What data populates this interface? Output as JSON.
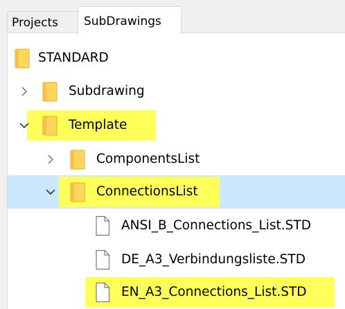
{
  "tabs": [
    {
      "label": "Projects",
      "active": false
    },
    {
      "label": "SubDrawings",
      "active": true
    }
  ],
  "tree": [
    {
      "label": "STANDARD",
      "type": "folder",
      "depth": 0,
      "state": "none",
      "selected": false,
      "highlighted": false
    },
    {
      "label": "Subdrawing",
      "type": "folder",
      "depth": 1,
      "state": "collapsed",
      "selected": false,
      "highlighted": false
    },
    {
      "label": "Template",
      "type": "folder",
      "depth": 1,
      "state": "expanded",
      "selected": false,
      "highlighted": true
    },
    {
      "label": "ComponentsList",
      "type": "folder",
      "depth": 2,
      "state": "collapsed",
      "selected": false,
      "highlighted": false
    },
    {
      "label": "ConnectionsList",
      "type": "folder",
      "depth": 2,
      "state": "expanded",
      "selected": true,
      "highlighted": true
    },
    {
      "label": "ANSI_B_Connections_List.STD",
      "type": "file",
      "depth": 3,
      "state": "none",
      "selected": false,
      "highlighted": false
    },
    {
      "label": "DE_A3_Verbindungsliste.STD",
      "type": "file",
      "depth": 3,
      "state": "none",
      "selected": false,
      "highlighted": false
    },
    {
      "label": "EN_A3_Connections_List.STD",
      "type": "file",
      "depth": 3,
      "state": "none",
      "selected": false,
      "highlighted": true
    }
  ],
  "colors": {
    "selection": "#cce8ff",
    "highlight": "#ffff5a",
    "folder_fill": "#ffd55c",
    "folder_tab": "#e8b83a",
    "file_stroke": "#7a7a7a"
  },
  "icons": {
    "folder": "folder-icon",
    "file": "file-icon",
    "collapsed": "chevron-right-icon",
    "expanded": "chevron-down-icon"
  }
}
